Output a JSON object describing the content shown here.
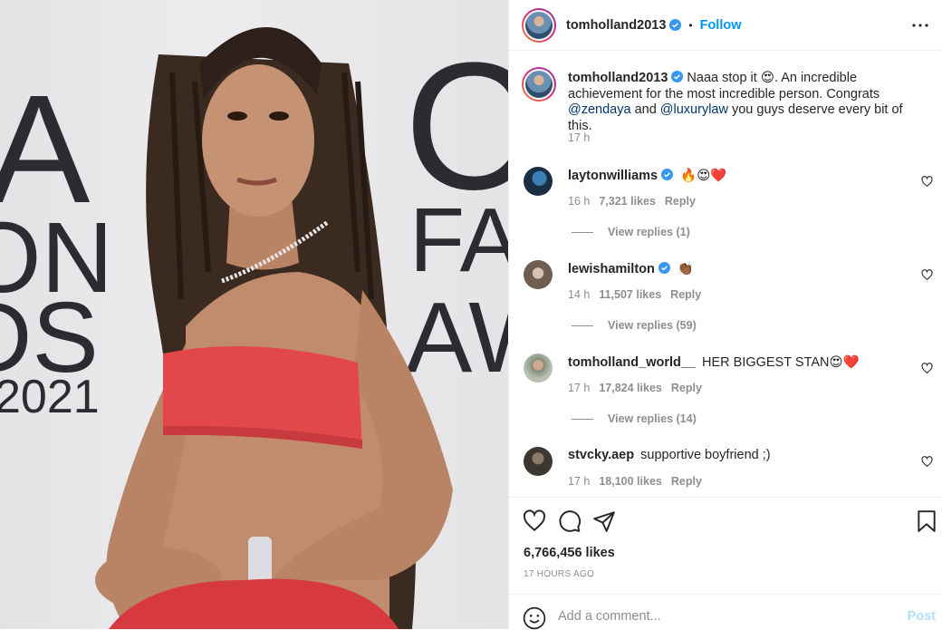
{
  "post": {
    "author": "tomholland2013",
    "follow_label": "Follow",
    "dot": "•",
    "backdrop_text": [
      "A",
      "ON",
      "DS",
      "2021",
      "C",
      "FA",
      "AW"
    ],
    "caption": {
      "username": "tomholland2013",
      "text_1": "Naaa stop it 😍. An incredible achievement for the most incredible person. Congrats ",
      "mention_1": "@zendaya",
      "text_2": " and ",
      "mention_2": "@luxurylaw",
      "text_3": " you guys deserve every bit of this.",
      "time": "17 h"
    },
    "comments": [
      {
        "username": "laytonwilliams",
        "verified": true,
        "text": "🔥😍❤️",
        "time": "16 h",
        "likes": "7,321 likes",
        "reply": "Reply",
        "view_replies": "View replies (1)",
        "avatar_color": "#1f3a5a"
      },
      {
        "username": "lewishamilton",
        "verified": true,
        "text": "👏🏾",
        "time": "14 h",
        "likes": "11,507 likes",
        "reply": "Reply",
        "view_replies": "View replies (59)",
        "avatar_color": "#7a6a5c"
      },
      {
        "username": "tomholland_world__",
        "verified": false,
        "text": "HER BIGGEST STAN😍❤️",
        "time": "17 h",
        "likes": "17,824 likes",
        "reply": "Reply",
        "view_replies": "View replies (14)",
        "avatar_color": "#8e9a88"
      },
      {
        "username": "stvcky.aep",
        "verified": false,
        "text": "supportive boyfriend ;)",
        "time": "17 h",
        "likes": "18,100 likes",
        "reply": "Reply",
        "view_replies": "",
        "avatar_color": "#4a4438"
      }
    ],
    "likes_count": "6,766,456 likes",
    "time_ago": "17 HOURS AGO",
    "add_comment_placeholder": "Add a comment...",
    "post_button": "Post"
  },
  "colors": {
    "accent": "#0095f6",
    "mention": "#00376b",
    "muted": "#8e8e8e",
    "dress": "#e2474c"
  }
}
